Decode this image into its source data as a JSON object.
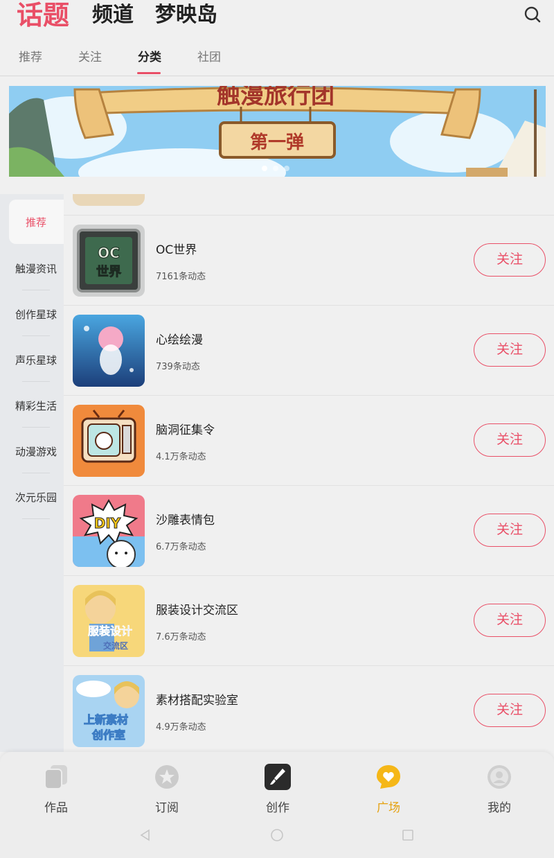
{
  "header": {
    "tabs": [
      {
        "label": "话题",
        "active": true
      },
      {
        "label": "频道",
        "active": false
      },
      {
        "label": "梦映岛",
        "active": false
      }
    ],
    "search_icon": "search-icon"
  },
  "subtabs": [
    {
      "label": "推荐",
      "active": false
    },
    {
      "label": "关注",
      "active": false
    },
    {
      "label": "分类",
      "active": true
    },
    {
      "label": "社团",
      "active": false
    }
  ],
  "banner": {
    "title_partial": "触漫旅行团",
    "subtitle": "第一弹",
    "dots": 3,
    "active_dot": 1
  },
  "sidebar": {
    "items": [
      {
        "label": "推荐",
        "active": true
      },
      {
        "label": "触漫资讯"
      },
      {
        "label": "创作星球"
      },
      {
        "label": "声乐星球"
      },
      {
        "label": "精彩生活"
      },
      {
        "label": "动漫游戏"
      },
      {
        "label": "次元乐园"
      }
    ]
  },
  "topics": [
    {
      "title": "OC世界",
      "count": "7161条动态",
      "follow": "关注",
      "thumb_text": "OC世界"
    },
    {
      "title": "心绘绘漫",
      "count": "739条动态",
      "follow": "关注"
    },
    {
      "title": "脑洞征集令",
      "count": "4.1万条动态",
      "follow": "关注"
    },
    {
      "title": "沙雕表情包",
      "count": "6.7万条动态",
      "follow": "关注",
      "thumb_text": "DIY"
    },
    {
      "title": "服装设计交流区",
      "count": "7.6万条动态",
      "follow": "关注",
      "thumb_text": "服装设计交流区"
    },
    {
      "title": "素材搭配实验室",
      "count": "4.9万条动态",
      "follow": "关注",
      "thumb_text": "上新素材创作室"
    }
  ],
  "bottom_nav": [
    {
      "label": "作品",
      "icon": "works-icon"
    },
    {
      "label": "订阅",
      "icon": "subscribe-icon"
    },
    {
      "label": "创作",
      "icon": "create-brush-icon"
    },
    {
      "label": "广场",
      "icon": "plaza-heart-icon",
      "active": true
    },
    {
      "label": "我的",
      "icon": "profile-icon"
    }
  ],
  "colors": {
    "accent": "#e94f67",
    "active_nav": "#e5a10f",
    "background": "#f0f0f0",
    "sidebar_bg": "#e7e9ec"
  }
}
